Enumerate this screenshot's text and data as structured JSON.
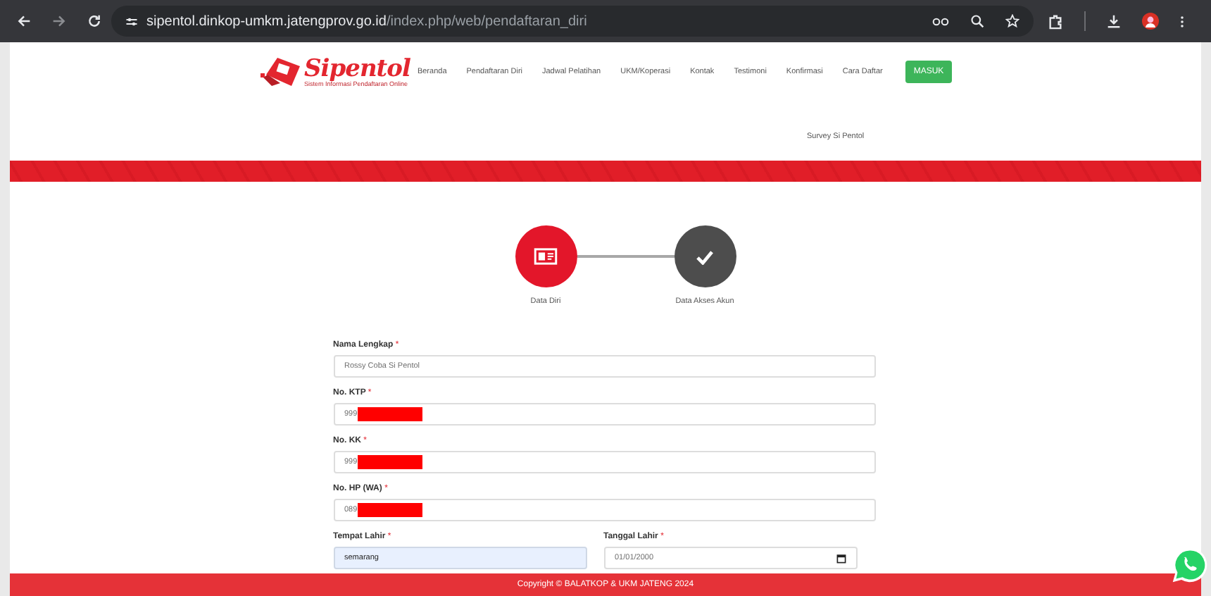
{
  "browser": {
    "url_host": "sipentol.dinkop-umkm.jatengprov.go.id",
    "url_path": "/index.php/web/pendaftaran_diri"
  },
  "header": {
    "logo_title": "Sipentol",
    "logo_tagline": "Sistem Informasi Pendaftaran Online",
    "nav": [
      "Beranda",
      "Pendaftaran Diri",
      "Jadwal Pelatihan",
      "UKM/Koperasi",
      "Kontak",
      "Testimoni",
      "Konfirmasi",
      "Cara Daftar"
    ],
    "login_button": "MASUK",
    "secondary_nav": [
      "Survey Si Pentol"
    ]
  },
  "steps": [
    {
      "label": "Data Diri",
      "kind": "id-card",
      "active": true
    },
    {
      "label": "Data Akses Akun",
      "kind": "check",
      "active": false
    }
  ],
  "form": {
    "fields": [
      {
        "label": "Nama Lengkap",
        "required_mark": "*",
        "value": "Rossy Coba Si Pentol",
        "redacted": false
      },
      {
        "label": "No. KTP",
        "required_mark": "*",
        "value": "999",
        "redacted": true
      },
      {
        "label": "No. KK",
        "required_mark": "*",
        "value": "999",
        "redacted": true
      },
      {
        "label": "No. HP (WA)",
        "required_mark": "*",
        "value": "089",
        "redacted": true
      }
    ],
    "row": [
      {
        "label": "Tempat Lahir",
        "required_mark": "*",
        "kind": "text",
        "value": "semarang",
        "autofilled": true
      },
      {
        "label": "Tanggal Lahir",
        "required_mark": "*",
        "kind": "date",
        "value": "01/01/2000",
        "autofilled": false
      }
    ]
  },
  "footer": "Copyright © BALATKOP & UKM JATENG 2024"
}
